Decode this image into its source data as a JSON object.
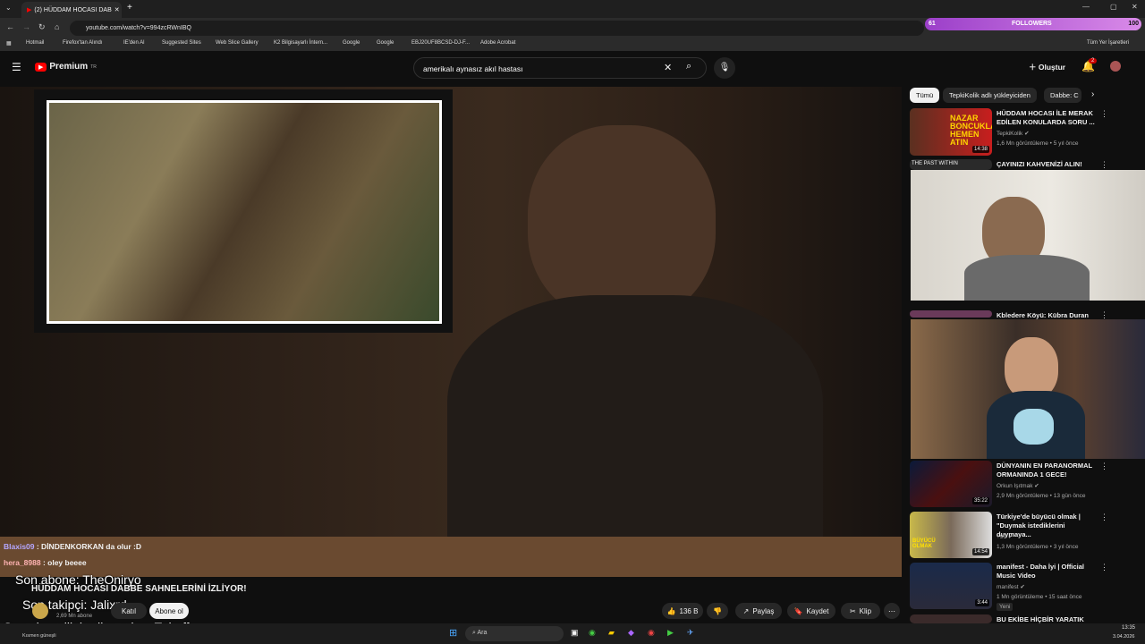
{
  "browser": {
    "tab_title": "(2) HÜDDAM HOCASI DAB",
    "url": "youtube.com/watch?v=994zcRWnIBQ",
    "bookmarks": [
      "Hotmail",
      "Firefox'tan Alındı",
      "IE'den Al",
      "Suggested Sites",
      "Web Slice Gallery",
      "K2 Bilgisayarlı İntern...",
      "Google",
      "Google",
      "EBJ20UF8BCSD-DJ-F...",
      "Adobe Acrobat"
    ],
    "all_bookmarks": "Tüm Yer İşaretleri"
  },
  "overlay": {
    "followers_label": "FOLLOWERS",
    "followers_left": "61",
    "followers_right": "100"
  },
  "yt": {
    "logo": "Premium",
    "logo_sup": "TR",
    "search_value": "amerikalı aynasız akıl hastası",
    "create": "Oluştur",
    "notif_count": "2"
  },
  "chat": [
    {
      "user": "Blaxis09",
      "msg": " : DİNDENKORKAN da olur :D"
    },
    {
      "user": "hera_8988",
      "msg": " : oley beeee"
    }
  ],
  "stream_overlay": {
    "last_sub": "Son abone: TheOniryo",
    "last_follower": "Son takipçi: Jalixrd",
    "last_gift": "Son abonelik hediye eden: Tuhaff"
  },
  "video": {
    "title": "HÜDDAM HOCASI DABBE SAHNELERİNİ İZLİYOR!",
    "channel_subs": "2,69 Mn abone",
    "join": "Katıl",
    "subscribe": "Abone ol",
    "likes": "136 B",
    "share": "Paylaş",
    "save": "Kaydet",
    "clip": "Klip"
  },
  "chips": [
    "Tümü",
    "TepkiKolik adlı yükleyiciden",
    "Dabbe: C"
  ],
  "sidebar": [
    {
      "title": "HÜDDAM HOCASI İLE MERAK EDİLEN KONULARDA SORU ...",
      "channel": "TepkiKolik",
      "meta": "1,6 Mn görüntüleme • 5 yıl önce",
      "dur": "14:38",
      "thumb_text": "NAZAR BONCUKLARI HEMEN ATIN"
    },
    {
      "title": "ÇAYINIZI KAHVENİZİ ALIN!",
      "thumb_text": "THE PAST WITHIN"
    },
    {
      "title": "Kbledere Köyü: Kübra Duran"
    },
    {
      "title": "DÜNYANIN EN PARANORMAL ORMANINDA 1 GECE!",
      "channel": "Orkun Işıtmak",
      "meta": "2,9 Mn görüntüleme • 13 gün önce",
      "dur": "35:22"
    },
    {
      "title": "Türkiye'de büyücü olmak | \"Duymak istediklerini duymaya...",
      "channel": "+90",
      "meta": "1,3 Mn görüntüleme • 3 yıl önce",
      "dur": "14:54",
      "thumb_text": "BÜYÜCÜ OLMAK"
    },
    {
      "title": "manifest - Daha İyi | Official Music Video",
      "channel": "manifest",
      "meta": "1 Mn görüntüleme • 15 saat önce",
      "badge": "Yeni",
      "dur": "3:44"
    },
    {
      "title": "BU EKİBE HİÇBİR YARATIK"
    }
  ],
  "taskbar": {
    "weather": "Kısmen güneşli",
    "search": "Ara",
    "time": "13:35",
    "date": "3.04.2026"
  }
}
